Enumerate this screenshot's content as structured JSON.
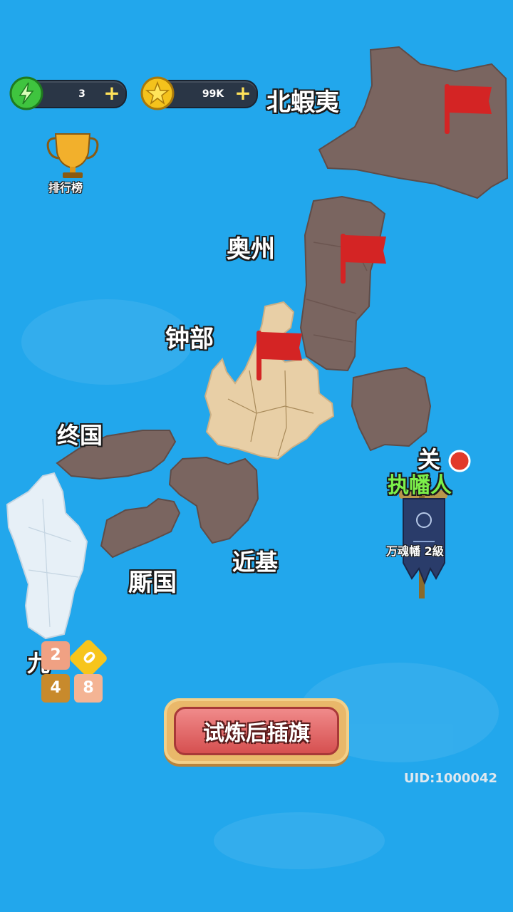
{
  "resources": {
    "energy": {
      "value": "3",
      "icon": "lightning-icon",
      "color": "#3fc43f"
    },
    "coins": {
      "value": "99K",
      "icon": "star-coin-icon",
      "color": "#f4c21c"
    },
    "plus_symbol": "+"
  },
  "leaderboard": {
    "label": "排行榜",
    "icon": "trophy-icon"
  },
  "regions": {
    "hokkaido": "北蝦夷",
    "oshu": "奥州",
    "chubu": "钟部",
    "shikoku_top": "终国",
    "kinki": "近基",
    "chugoku": "厮国",
    "kanto_partial": "关",
    "kyushu_partial": "九"
  },
  "banner_holder": {
    "title": "执幡人",
    "item": "万魂幡 2級"
  },
  "game_2048_tiles": [
    "2",
    "0",
    "4",
    "8"
  ],
  "trial_button": {
    "label": "试炼后插旗"
  },
  "uid": "UID:1000042",
  "colors": {
    "ocean": "#22a7ec",
    "conquered": "#7a6560",
    "current": "#e8cfa6",
    "ice": "#e7f0f7",
    "flag": "#d42424"
  }
}
